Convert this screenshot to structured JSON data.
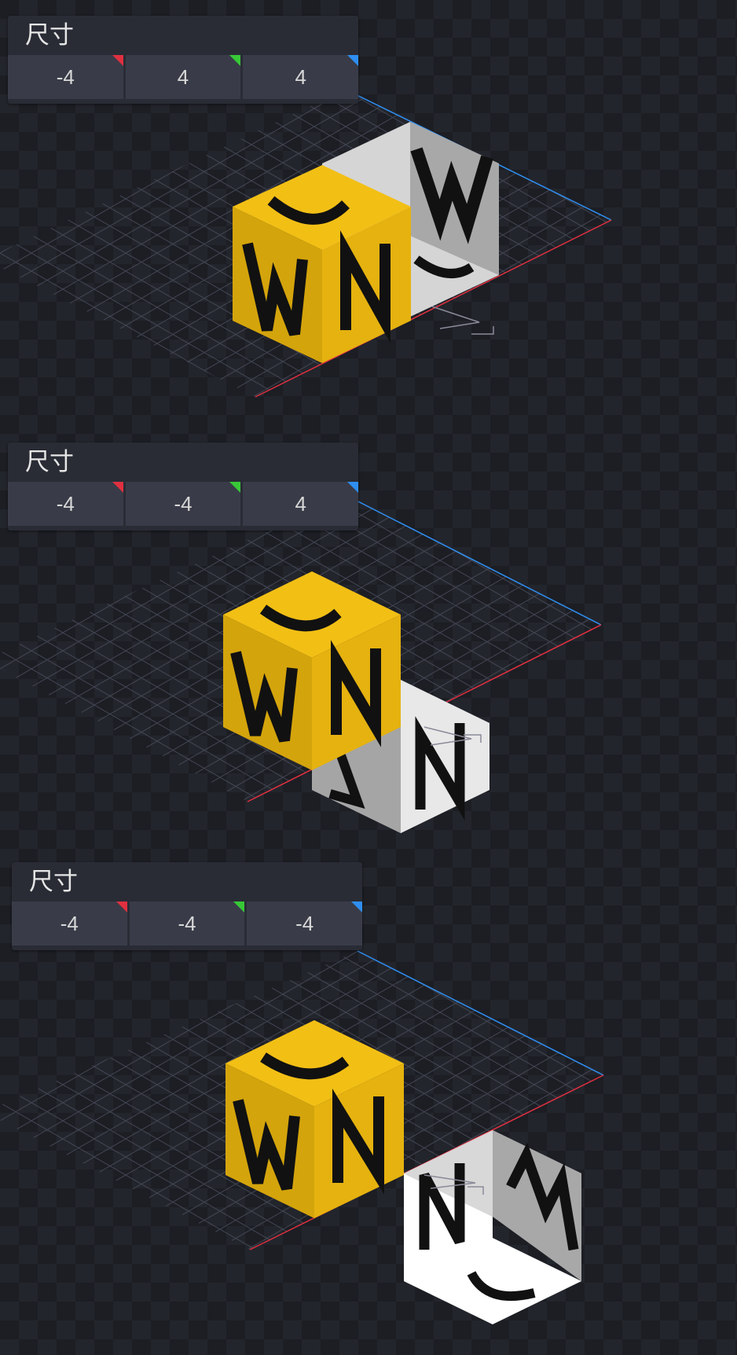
{
  "panels": [
    {
      "title": "尺寸",
      "x": "-4",
      "y": "4",
      "z": "4"
    },
    {
      "title": "尺寸",
      "x": "-4",
      "y": "-4",
      "z": "4"
    },
    {
      "title": "尺寸",
      "x": "-4",
      "y": "-4",
      "z": "-4"
    }
  ],
  "colors": {
    "axis_x": "#e03040",
    "axis_y": "#38c837",
    "axis_z": "#2f8ef0",
    "cube_yellow": "#e5b20f",
    "cube_white": "#e0e0e0"
  }
}
